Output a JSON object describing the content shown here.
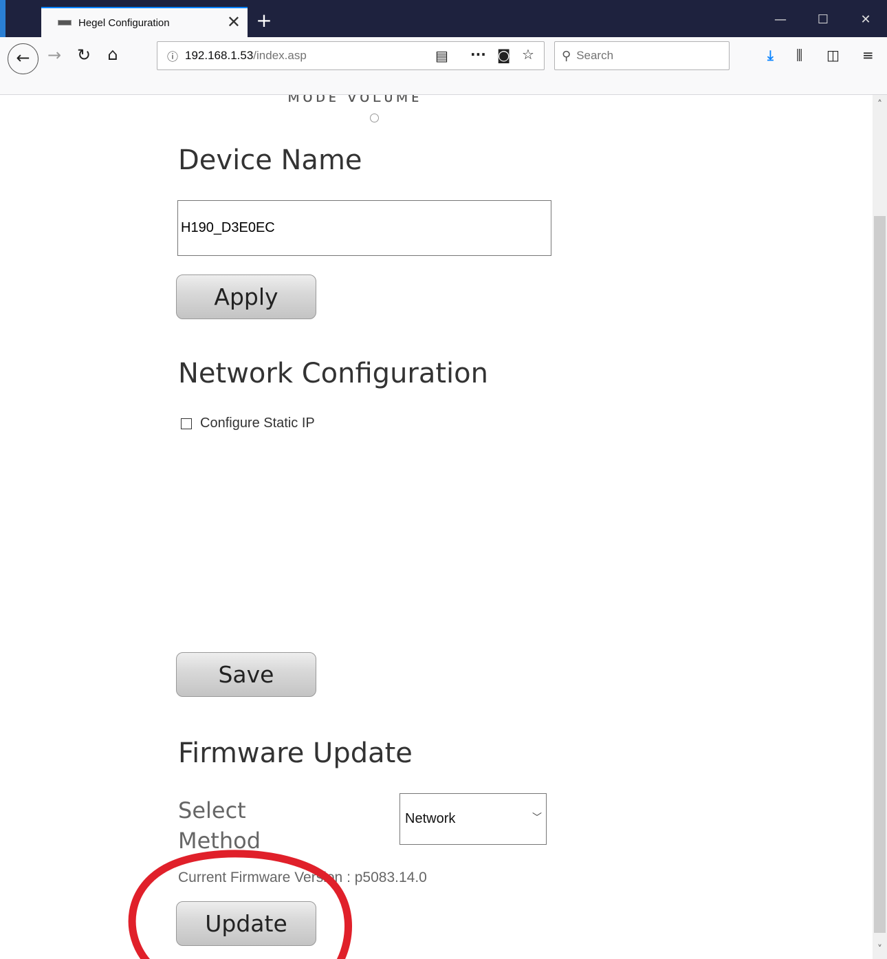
{
  "browser": {
    "tab_title": "Hegel Configuration",
    "new_tab_label": "+",
    "url_host": "192.168.1.53",
    "url_path": "/index.asp",
    "search_placeholder": "Search"
  },
  "page": {
    "cutoff_text": "ᴍᴏᴅᴇ ᴠᴏʟᴜᴍᴇ",
    "device_name": {
      "title": "Device Name",
      "value": "H190_D3E0EC",
      "apply_label": "Apply"
    },
    "network": {
      "title": "Network Configuration",
      "static_ip_label": "Configure Static IP",
      "save_label": "Save"
    },
    "firmware": {
      "title": "Firmware Update",
      "select_method_label": "Select Method",
      "method_value": "Network",
      "version_label": "Current Firmware Version : ",
      "version_value": "p5083.14.0",
      "update_label": "Update"
    }
  },
  "colors": {
    "titlebar": "#1e223e",
    "tab_accent": "#0a84ff",
    "annotation_circle": "#e0202a",
    "download_icon": "#0a84ff"
  },
  "icons": [
    "back-arrow-icon",
    "forward-arrow-icon",
    "reload-icon",
    "home-icon",
    "info-icon",
    "reader-view-icon",
    "more-actions-icon",
    "pocket-icon",
    "bookmark-star-icon",
    "search-icon",
    "download-icon",
    "library-icon",
    "sidebar-icon",
    "menu-icon"
  ]
}
